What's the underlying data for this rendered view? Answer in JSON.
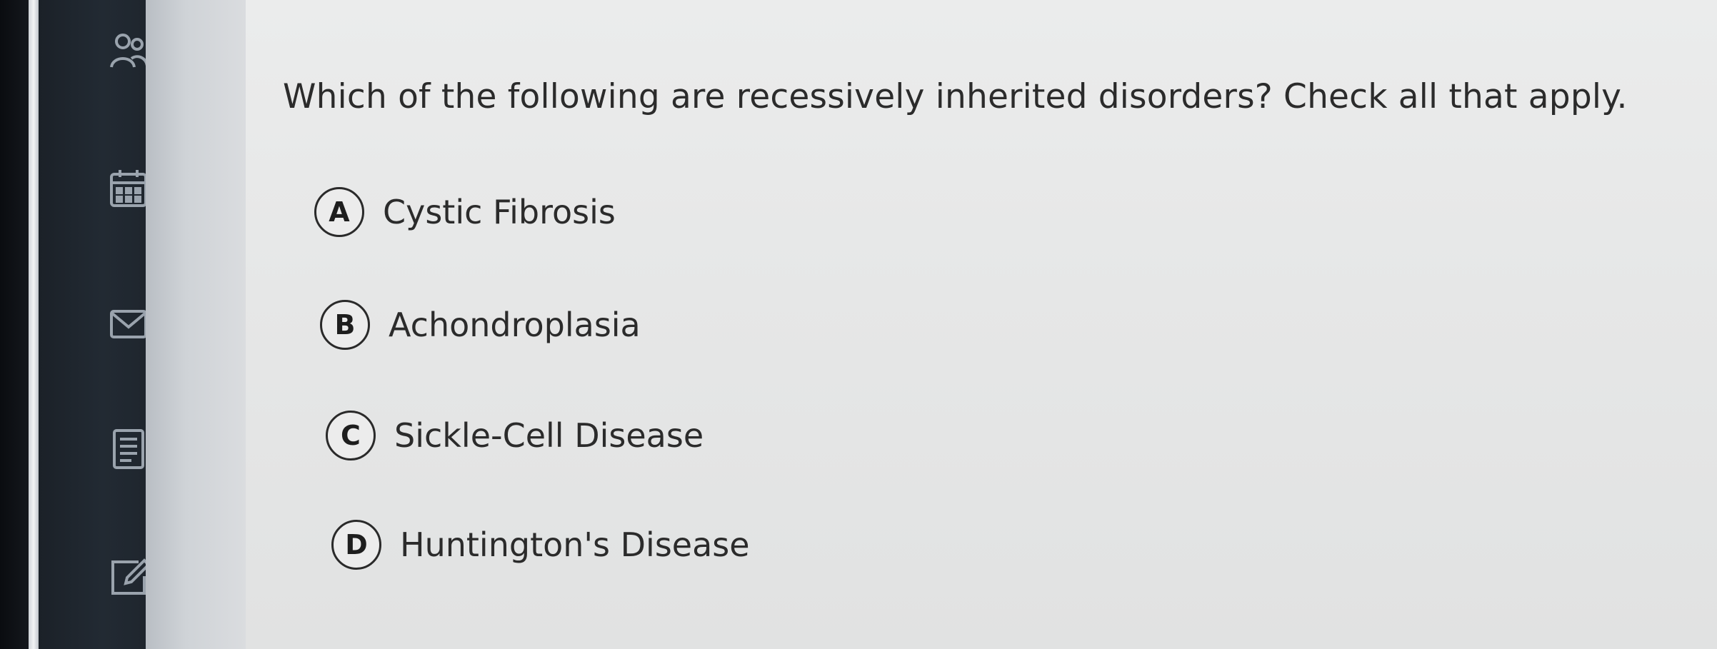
{
  "question": {
    "text": "Which of the following are recessively inherited disorders? Check all that apply."
  },
  "options": [
    {
      "letter": "A",
      "label": "Cystic Fibrosis"
    },
    {
      "letter": "B",
      "label": "Achondroplasia"
    },
    {
      "letter": "C",
      "label": "Sickle-Cell Disease"
    },
    {
      "letter": "D",
      "label": "Huntington's Disease"
    }
  ],
  "sidebar": {
    "icons": [
      "people-icon",
      "calendar-icon",
      "mail-icon",
      "document-icon",
      "edit-icon"
    ]
  },
  "colors": {
    "text": "#2b2b2b",
    "background": "#e8e9e9",
    "rail": "#1f262e",
    "icon": "#9aa3ad"
  }
}
